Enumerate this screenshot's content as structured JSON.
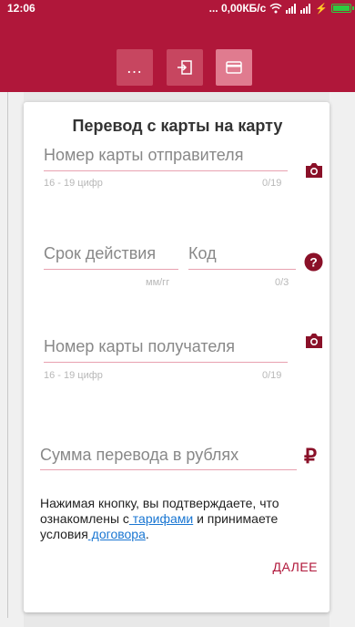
{
  "status": {
    "time": "12:06",
    "net_speed": "... 0,00КБ/с"
  },
  "toolbar": {
    "more_label": "…"
  },
  "form": {
    "title": "Перевод с карты на карту",
    "sender_card": {
      "placeholder": "Номер карты отправителя",
      "hint": "16 - 19 цифр",
      "counter": "0/19"
    },
    "expiry": {
      "placeholder": "Срок действия",
      "hint": "мм/гг"
    },
    "code": {
      "placeholder": "Код",
      "counter": "0/3"
    },
    "recipient_card": {
      "placeholder": "Номер карты получателя",
      "hint": "16 - 19 цифр",
      "counter": "0/19"
    },
    "amount": {
      "placeholder": "Сумма перевода в рублях",
      "currency_symbol": "₽"
    },
    "legal": {
      "part1": "Нажимая кнопку, вы подтверждаете, что ознакомлены с",
      "tariffs_link": " тарифами",
      "part2": " и принимаете условия",
      "contract_link": " договора",
      "part3": "."
    },
    "next_label": "ДАЛЕЕ"
  },
  "colors": {
    "brand": "#b0173a",
    "underline": "#e8a1b0",
    "link": "#1976d2"
  },
  "icons": [
    "wifi-icon",
    "signal-icon",
    "battery-icon",
    "more-icon",
    "login-icon",
    "card-icon",
    "camera-icon",
    "help-icon",
    "ruble-icon"
  ]
}
